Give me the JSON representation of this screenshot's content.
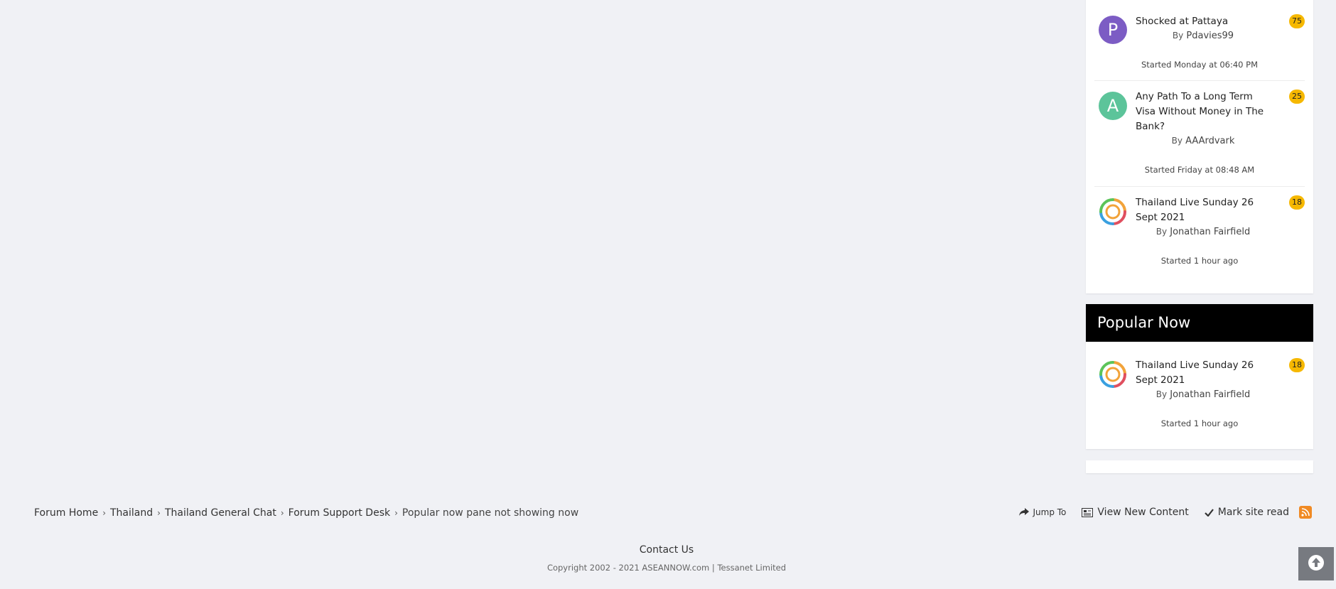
{
  "sidebar": {
    "recent_topics": [
      {
        "title": "Shocked at Pattaya",
        "by_prefix": "By",
        "author": "Pdavies99",
        "started": "Started Monday at 06:40 PM",
        "replies": "75",
        "avatar_letter": "P",
        "avatar_color": "#7c5cc4"
      },
      {
        "title": "Any Path To a Long Term Visa Without Money in The Bank?",
        "by_prefix": "By",
        "author": "AAArdvark",
        "started": "Started Friday at 08:48 AM",
        "replies": "25",
        "avatar_letter": "A",
        "avatar_color": "#5cc49a"
      },
      {
        "title": "Thailand Live Sunday 26 Sept 2021",
        "by_prefix": "By",
        "author": "Jonathan Fairfield",
        "started": "Started 1 hour ago",
        "replies": "18",
        "avatar_icon": "ring-logo-icon"
      }
    ],
    "popular_now": {
      "header": "Popular Now",
      "topics": [
        {
          "title": "Thailand Live Sunday 26 Sept 2021",
          "by_prefix": "By",
          "author": "Jonathan Fairfield",
          "started": "Started 1 hour ago",
          "replies": "18",
          "avatar_icon": "ring-logo-icon"
        }
      ]
    }
  },
  "breadcrumb": {
    "items": [
      "Forum Home",
      "Thailand",
      "Thailand General Chat",
      "Forum Support Desk"
    ],
    "current": "Popular now pane not showing now"
  },
  "footer_actions": {
    "jump_to": "Jump To",
    "view_new_content": "View New Content",
    "mark_site_read": "Mark site read",
    "rss_icon": "rss-icon"
  },
  "footer": {
    "contact": "Contact Us",
    "copyright": "Copyright 2002 - 2021 ASEANNOW.com | Tessanet Limited"
  },
  "colors": {
    "badge": "#f6b800",
    "header_bg": "#000000",
    "page_bg": "#f0f1f5",
    "rss": "#f08a24"
  }
}
